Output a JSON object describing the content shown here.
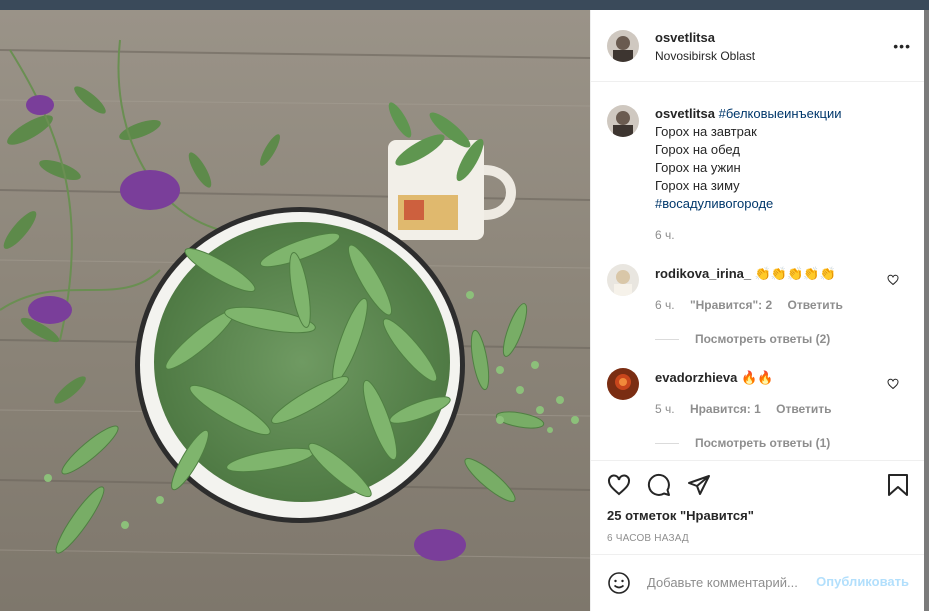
{
  "post": {
    "author": "osvetlitsa",
    "location": "Novosibirsk Oblast",
    "more_label": "•••"
  },
  "caption": {
    "author": "osvetlitsa",
    "hashtag1": "#белковыеинъекции",
    "lines": [
      "Горох на завтрак",
      "Горох на обед",
      "Горох на ужин",
      "Горох на зиму"
    ],
    "hashtag2": "#восадуливогороде",
    "time": "6 ч."
  },
  "comments": [
    {
      "author": "rodikova_irina_",
      "text": "👏👏👏👏👏",
      "time": "6 ч.",
      "likes": "\"Нравится\": 2",
      "reply": "Ответить",
      "view_replies": "Посмотреть ответы (2)"
    },
    {
      "author": "evadorzhieva",
      "text": "🔥🔥",
      "time": "5 ч.",
      "likes": "Нравится: 1",
      "reply": "Ответить",
      "view_replies": "Посмотреть ответы (1)"
    }
  ],
  "likes_count": "25 отметок \"Нравится\"",
  "posted_ago": "6 ЧАСОВ НАЗАД",
  "comment_box": {
    "placeholder": "Добавьте комментарий...",
    "publish": "Опубликовать"
  },
  "colors": {
    "link": "#00376b",
    "publish": "#b2dffc",
    "muted": "#8e8e8e"
  }
}
